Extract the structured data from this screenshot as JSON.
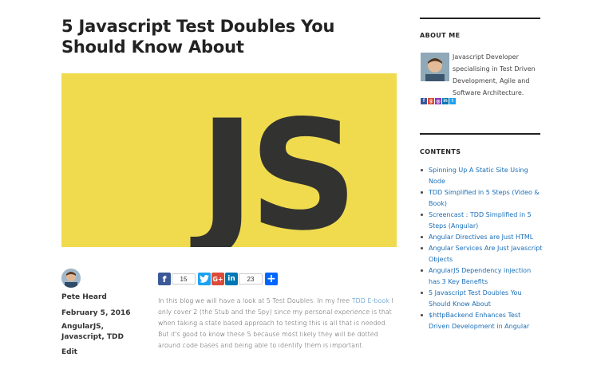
{
  "post": {
    "title": "5 Javascript Test Doubles You Should Know About",
    "hero_text": "JS",
    "author": "Pete Heard",
    "date": "February 5, 2016",
    "tags": "AngularJS, Javascript, TDD",
    "edit_label": "Edit",
    "body_part1": "In this blog we will have a look at 5 Test Doubles. In my free ",
    "body_link": "TDD E-book",
    "body_part2": " I only cover 2 (the Stub and the Spy) since my personal experience is that when taking a state based approach to testing this is all that is needed. But it's good to know these 5 because most likely they will be dotted around code bases and being able to identify them is important."
  },
  "share": {
    "facebook_count": "15",
    "linkedin_count": "23",
    "facebook_icon": "facebook-icon",
    "twitter_icon": "twitter-icon",
    "googleplus_icon": "google-plus-icon",
    "linkedin_icon": "linkedin-icon",
    "add_icon": "plus-icon",
    "googleplus_label": "G+",
    "linkedin_label": "in",
    "facebook_label": "f",
    "plus_label": "+"
  },
  "sidebar": {
    "about_title": "ABOUT ME",
    "about_text": "Javascript Developer specialising in Test Driven Development, Agile and Software Architecture.",
    "contents_title": "CONTENTS",
    "contents": [
      "Spinning Up A Static Site Using Node",
      "TDD Simplified in 5 Steps (Video & Book)",
      "Screencast : TDD Simplified in 5 Steps (Angular)",
      "Angular Directives are Just HTML",
      "Angular Services Are Just Javascript Objects",
      "AngularJS Dependency injection has 3 Key Benefits",
      "5 Javascript Test Doubles You Should Know About",
      "$httpBackend Enhances Test Driven Development in Angular"
    ]
  },
  "colors": {
    "js_yellow": "#f0db4f",
    "js_dark": "#323330",
    "link": "#1a6fb8"
  }
}
